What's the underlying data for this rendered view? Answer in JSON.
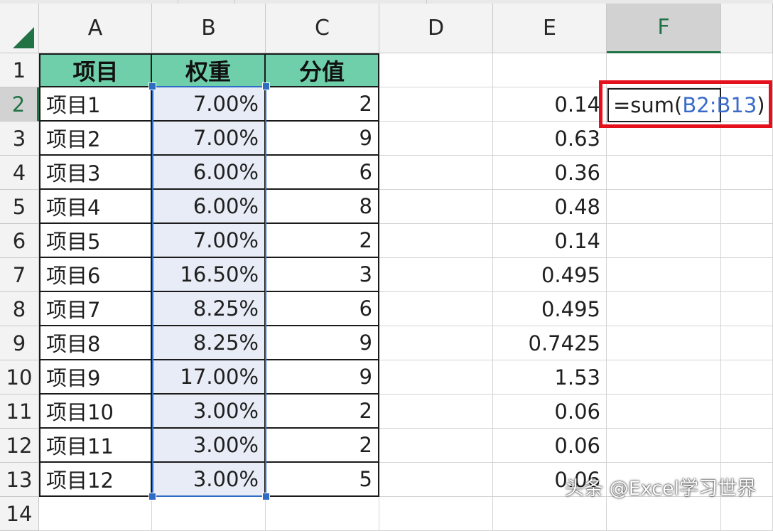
{
  "columns": [
    "A",
    "B",
    "C",
    "D",
    "E",
    "F"
  ],
  "selected_column": "F",
  "rows": [
    "1",
    "2",
    "3",
    "4",
    "5",
    "6",
    "7",
    "8",
    "9",
    "10",
    "11",
    "12",
    "13",
    "14"
  ],
  "selected_row": "2",
  "header_row": {
    "A": "项目",
    "B": "权重",
    "C": "分值"
  },
  "data_rows": [
    {
      "A": "项目1",
      "B": "7.00%",
      "C": "2",
      "E": "0.14"
    },
    {
      "A": "项目2",
      "B": "7.00%",
      "C": "9",
      "E": "0.63"
    },
    {
      "A": "项目3",
      "B": "6.00%",
      "C": "6",
      "E": "0.36"
    },
    {
      "A": "项目4",
      "B": "6.00%",
      "C": "8",
      "E": "0.48"
    },
    {
      "A": "项目5",
      "B": "7.00%",
      "C": "2",
      "E": "0.14"
    },
    {
      "A": "项目6",
      "B": "16.50%",
      "C": "3",
      "E": "0.495"
    },
    {
      "A": "项目7",
      "B": "8.25%",
      "C": "6",
      "E": "0.495"
    },
    {
      "A": "项目8",
      "B": "8.25%",
      "C": "9",
      "E": "0.7425"
    },
    {
      "A": "项目9",
      "B": "17.00%",
      "C": "9",
      "E": "1.53"
    },
    {
      "A": "项目10",
      "B": "3.00%",
      "C": "2",
      "E": "0.06"
    },
    {
      "A": "项目11",
      "B": "3.00%",
      "C": "2",
      "E": "0.06"
    },
    {
      "A": "项目12",
      "B": "3.00%",
      "C": "5",
      "E": "0.06"
    }
  ],
  "editing_cell": {
    "address": "F2",
    "formula_prefix": "=sum(",
    "formula_ref": "B2:B13",
    "formula_suffix": ")"
  },
  "watermark": "头条 @Excel学习世界",
  "colors": {
    "header_fill": "#6fcfab",
    "selection": "#2f6cc4",
    "highlight_box": "#e4101c",
    "excel_green": "#217346"
  }
}
